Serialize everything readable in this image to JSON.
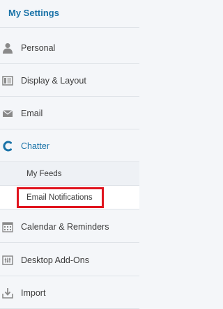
{
  "header": {
    "title": "My Settings"
  },
  "nav": {
    "personal": {
      "label": "Personal",
      "icon": "person-icon"
    },
    "display": {
      "label": "Display & Layout",
      "icon": "layout-icon"
    },
    "email": {
      "label": "Email",
      "icon": "envelope-icon"
    },
    "chatter": {
      "label": "Chatter",
      "icon": "chatter-icon",
      "subitems": {
        "my_feeds": "My Feeds",
        "email_notifications": "Email Notifications"
      }
    },
    "calendar": {
      "label": "Calendar & Reminders",
      "icon": "calendar-icon"
    },
    "desktop": {
      "label": "Desktop Add-Ons",
      "icon": "desktop-addons-icon"
    },
    "import": {
      "label": "Import",
      "icon": "import-icon"
    }
  },
  "colors": {
    "accent": "#1a73a8",
    "highlight": "#e0141e",
    "icon": "#8a8a8a"
  }
}
